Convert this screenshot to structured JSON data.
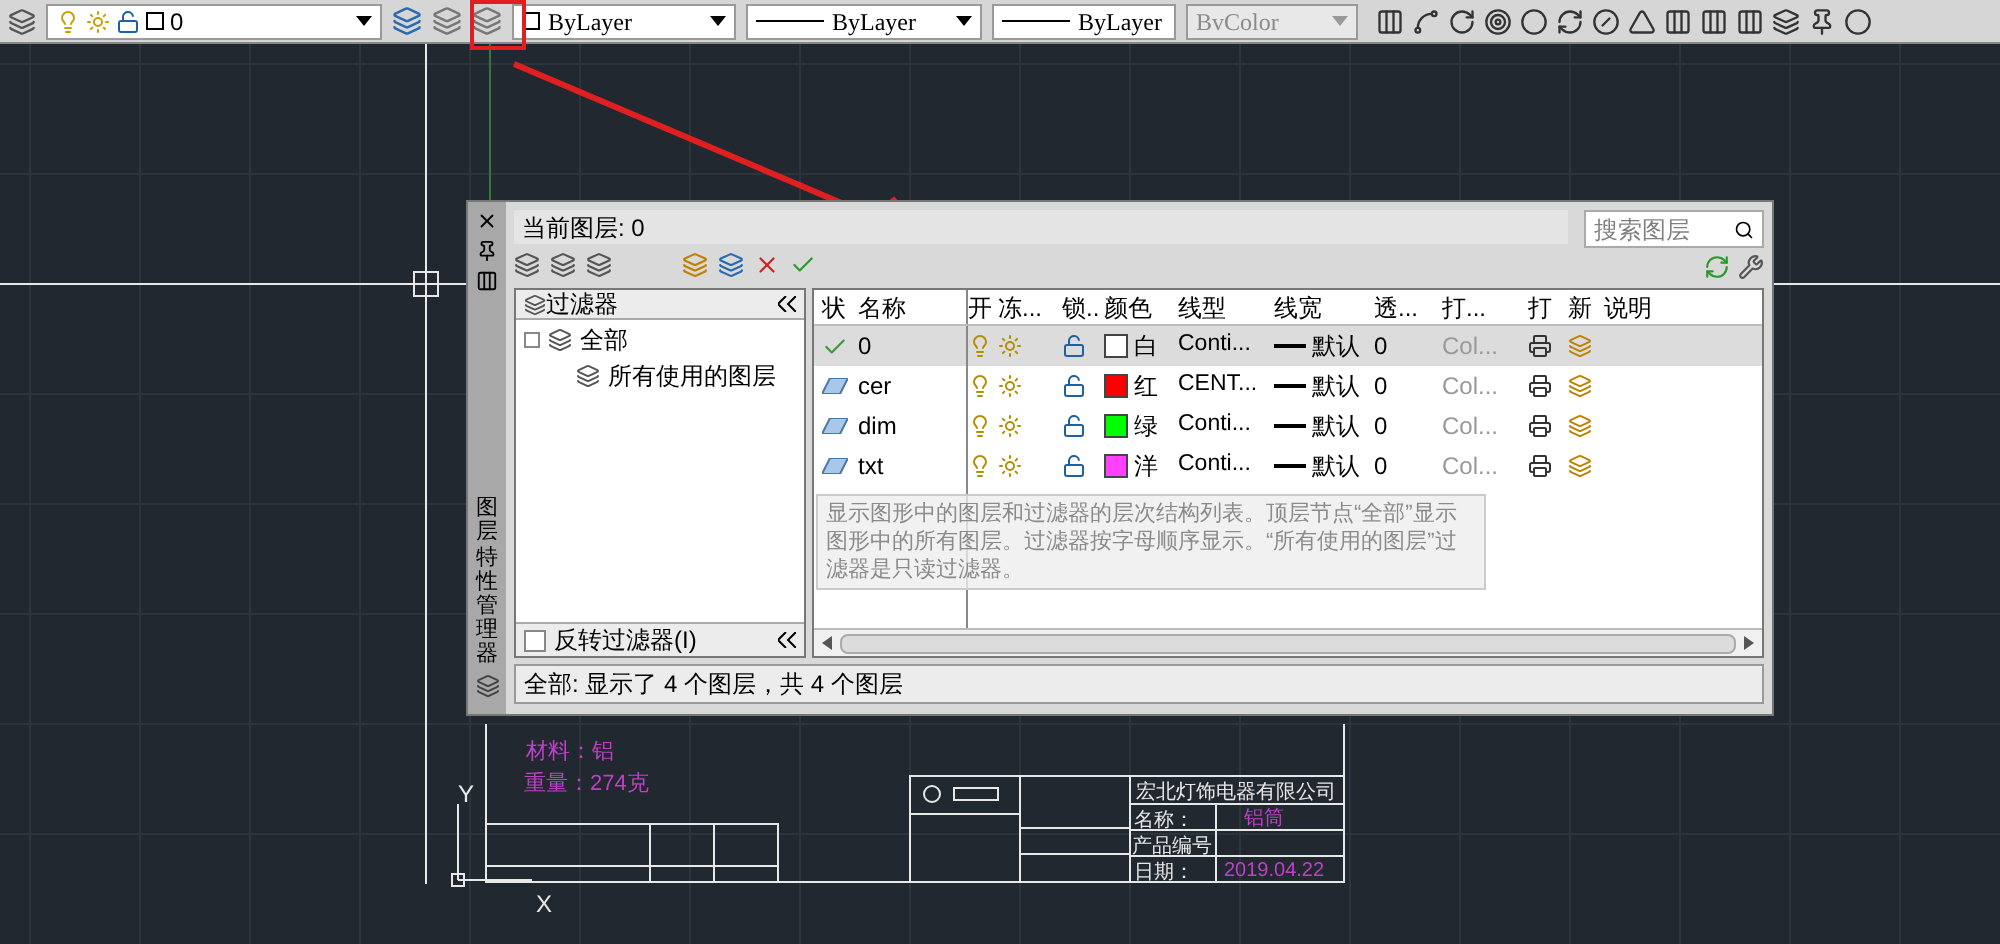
{
  "toolbar": {
    "layer_dropdown": {
      "value": "0"
    },
    "color_dropdown": {
      "value": "ByLayer"
    },
    "linetype_dropdown": {
      "value": "ByLayer"
    },
    "lineweight_dropdown": {
      "value": "ByLayer"
    },
    "plotstyle_dropdown": {
      "value": "BvColor",
      "disabled": true
    }
  },
  "palette": {
    "title": "图层特性管理器",
    "current_layer": "当前图层: 0",
    "search": {
      "placeholder": "搜索图层"
    },
    "filter_tree": {
      "heading": "过滤器",
      "items": [
        {
          "label": "全部",
          "children": [
            {
              "label": "所有使用的图层"
            }
          ]
        }
      ]
    },
    "invert_filter": {
      "label": "反转过滤器(I)",
      "checked": false
    },
    "columns": [
      "状",
      "名称",
      "开",
      "冻...",
      "锁..",
      "颜色",
      "线型",
      "线宽",
      "透...",
      "打...",
      "打",
      "新",
      "说明"
    ],
    "layers": [
      {
        "name": "0",
        "current": true,
        "selected": true,
        "color": "#ffffff",
        "color_name": "白",
        "linetype": "Conti...",
        "lineweight": "默认",
        "transparency": "0",
        "plot_style": "Col..."
      },
      {
        "name": "cer",
        "current": false,
        "selected": false,
        "color": "#ff0000",
        "color_name": "红",
        "linetype": "CENT...",
        "lineweight": "默认",
        "transparency": "0",
        "plot_style": "Col..."
      },
      {
        "name": "dim",
        "current": false,
        "selected": false,
        "color": "#00ff00",
        "color_name": "绿",
        "linetype": "Conti...",
        "lineweight": "默认",
        "transparency": "0",
        "plot_style": "Col..."
      },
      {
        "name": "txt",
        "current": false,
        "selected": false,
        "color": "#ff40ff",
        "color_name": "洋",
        "linetype": "Conti...",
        "lineweight": "默认",
        "transparency": "0",
        "plot_style": "Col..."
      }
    ],
    "tooltip": "显示图形中的图层和过滤器的层次结构列表。顶层节点“全部”显示图形中的所有图层。过滤器按字母顺序显示。“所有使用的图层”过滤器是只读过滤器。",
    "status_bar": "全部: 显示了 4 个图层，共 4 个图层"
  },
  "drawing": {
    "material": "材料：铝",
    "weight": "重量：274克",
    "company": "宏北灯饰电器有限公司",
    "name_label": "名称：",
    "name_value": "铝筒",
    "product_no_label": "产品编号",
    "date_label": "日期：",
    "date_value": "2019.04.22",
    "ucs_y": "Y",
    "ucs_x": "X"
  }
}
